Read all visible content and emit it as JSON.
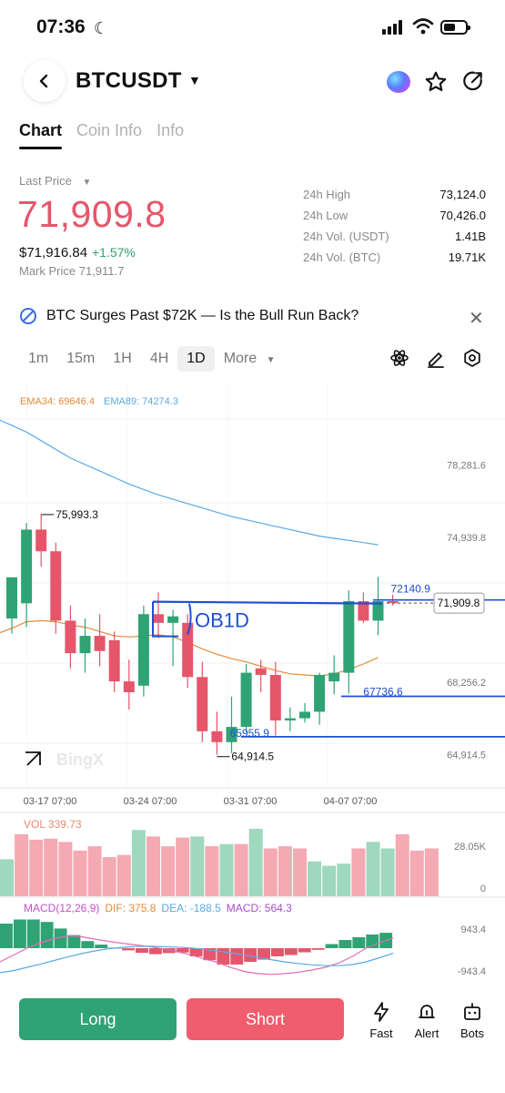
{
  "status_bar": {
    "time": "07:36"
  },
  "header": {
    "symbol": "BTCUSDT"
  },
  "tabs": [
    {
      "label": "Chart",
      "active": true
    },
    {
      "label": "Coin Info",
      "active": false
    },
    {
      "label": "Info",
      "active": false
    }
  ],
  "price": {
    "last_price_label": "Last Price",
    "last_price": "71,909.8",
    "usd_price": "$71,916.84",
    "change": "+1.57%",
    "mark_price": "Mark Price 71,911.7"
  },
  "stats": [
    {
      "label": "24h High",
      "value": "73,124.0"
    },
    {
      "label": "24h Low",
      "value": "70,426.0"
    },
    {
      "label": "24h Vol. (USDT)",
      "value": "1.41B"
    },
    {
      "label": "24h Vol. (BTC)",
      "value": "19.71K"
    }
  ],
  "news": {
    "headline": "BTC Surges Past $72K — Is the Bull Run Back?"
  },
  "timeframes": [
    {
      "label": "1m",
      "active": false
    },
    {
      "label": "15m",
      "active": false
    },
    {
      "label": "1H",
      "active": false
    },
    {
      "label": "4H",
      "active": false
    },
    {
      "label": "1D",
      "active": true
    },
    {
      "label": "More",
      "active": false
    }
  ],
  "indicators": {
    "ema34": "EMA34: 69646.4",
    "ema89": "EMA89: 74274.3",
    "vol": "VOL 339.73",
    "macd_params": "MACD(12,26,9)",
    "dif": "DIF: 375.8",
    "dea": "DEA: -188.5",
    "macd": "MACD: 564.3"
  },
  "chart_data": {
    "type": "candlestick",
    "x_ticks": [
      "03-17 07:00",
      "03-24 07:00",
      "03-31 07:00",
      "04-07 07:00"
    ],
    "y_ticks": [
      "78,281.6",
      "74,939.8",
      "68,256.2",
      "64,914.5"
    ],
    "y_tick_values": [
      78281.6,
      74939.8,
      68256.2,
      64914.5
    ],
    "ylim": [
      63600,
      80400
    ],
    "price_tag": "71,909.8",
    "marks": [
      {
        "label": "75,993.3",
        "value": 75993.3,
        "index": 2
      },
      {
        "label": "64,914.5",
        "value": 64914.5,
        "index": 14
      },
      {
        "label": "65955.9",
        "value": 65955.9,
        "index": 16
      },
      {
        "label": "67736.6",
        "value": 67736.6,
        "index": 23
      },
      {
        "label": "72140.9",
        "value": 72140.9,
        "index": 25
      }
    ],
    "annotation": "OB1D",
    "watermark": "BingX",
    "candles": [
      {
        "o": 71200,
        "h": 72400,
        "l": 70500,
        "c": 73100
      },
      {
        "o": 71900,
        "h": 75600,
        "l": 70800,
        "c": 75300
      },
      {
        "o": 75300,
        "h": 75993.3,
        "l": 73600,
        "c": 74300
      },
      {
        "o": 74300,
        "h": 74700,
        "l": 70500,
        "c": 71100
      },
      {
        "o": 71100,
        "h": 71800,
        "l": 68900,
        "c": 69600
      },
      {
        "o": 69600,
        "h": 71200,
        "l": 68700,
        "c": 70400
      },
      {
        "o": 70400,
        "h": 71400,
        "l": 69000,
        "c": 69700
      },
      {
        "o": 70200,
        "h": 70600,
        "l": 67800,
        "c": 68300
      },
      {
        "o": 68300,
        "h": 69300,
        "l": 67000,
        "c": 67800
      },
      {
        "o": 68100,
        "h": 71800,
        "l": 67600,
        "c": 71400
      },
      {
        "o": 71400,
        "h": 72400,
        "l": 70300,
        "c": 71000
      },
      {
        "o": 71000,
        "h": 71600,
        "l": 69000,
        "c": 71300
      },
      {
        "o": 71000,
        "h": 71400,
        "l": 68000,
        "c": 68500
      },
      {
        "o": 68500,
        "h": 69200,
        "l": 65500,
        "c": 66000
      },
      {
        "o": 66000,
        "h": 66900,
        "l": 64914.5,
        "c": 65500
      },
      {
        "o": 65500,
        "h": 67600,
        "l": 65000,
        "c": 66200
      },
      {
        "o": 66200,
        "h": 69100,
        "l": 65955.9,
        "c": 68700
      },
      {
        "o": 68900,
        "h": 69300,
        "l": 67800,
        "c": 68600
      },
      {
        "o": 68600,
        "h": 69200,
        "l": 65800,
        "c": 66500
      },
      {
        "o": 66500,
        "h": 67100,
        "l": 66000,
        "c": 66600
      },
      {
        "o": 66600,
        "h": 67300,
        "l": 66400,
        "c": 66900
      },
      {
        "o": 66900,
        "h": 68700,
        "l": 66300,
        "c": 68600
      },
      {
        "o": 68300,
        "h": 69500,
        "l": 67700,
        "c": 68700
      },
      {
        "o": 68700,
        "h": 72500,
        "l": 67736.6,
        "c": 72000
      },
      {
        "o": 72000,
        "h": 72400,
        "l": 71000,
        "c": 71100
      },
      {
        "o": 71100,
        "h": 73124,
        "l": 70426,
        "c": 72000
      },
      {
        "o": 72000,
        "h": 72300,
        "l": 71800,
        "c": 71909.8
      }
    ],
    "ema89": [
      80400,
      80100,
      79800,
      79400,
      79000,
      78600,
      78300,
      78000,
      77700,
      77400,
      77150,
      76900,
      76700,
      76500,
      76300,
      76100,
      75900,
      75750,
      75600,
      75450,
      75300,
      75150,
      75000,
      74900,
      74800,
      74700,
      74600
    ],
    "ema34": [
      70500,
      70750,
      71050,
      71100,
      71050,
      70900,
      70800,
      70600,
      70400,
      70350,
      70400,
      70450,
      70350,
      70100,
      69800,
      69550,
      69350,
      69200,
      69000,
      68800,
      68650,
      68600,
      68550,
      68650,
      68850,
      69100,
      69400
    ],
    "volume": {
      "ticks": [
        "28.05K",
        "0"
      ],
      "max": 31000,
      "values": [
        17000,
        28500,
        26000,
        26500,
        25000,
        21000,
        23000,
        18000,
        19000,
        30500,
        27500,
        23000,
        27000,
        27500,
        23000,
        24000,
        24000,
        31000,
        22000,
        23000,
        22000,
        16000,
        14000,
        15000,
        22000,
        25000,
        22000,
        28500,
        21000,
        22000
      ]
    },
    "macd": {
      "ticks": [
        "943.4",
        "-943.4"
      ],
      "range": [
        -1300,
        1300
      ],
      "hist": [
        900,
        1050,
        1050,
        960,
        720,
        480,
        260,
        130,
        20,
        -80,
        -170,
        -220,
        -180,
        -160,
        -300,
        -440,
        -600,
        -600,
        -500,
        -420,
        -300,
        -250,
        -150,
        -60,
        150,
        300,
        400,
        500,
        564
      ],
      "dif": [
        -500,
        -250,
        0,
        200,
        350,
        450,
        420,
        330,
        250,
        180,
        120,
        60,
        -20,
        -120,
        -240,
        -380,
        -520,
        -700,
        -850,
        -930,
        -960,
        -930,
        -880,
        -800,
        -700,
        -540,
        -300,
        0,
        200,
        376
      ],
      "dea": [
        -900,
        -820,
        -700,
        -580,
        -450,
        -320,
        -200,
        -100,
        -20,
        30,
        60,
        70,
        60,
        40,
        10,
        -40,
        -100,
        -170,
        -250,
        -330,
        -420,
        -500,
        -560,
        -610,
        -640,
        -640,
        -600,
        -500,
        -350,
        -188
      ]
    }
  },
  "actions": {
    "long": "Long",
    "short": "Short",
    "fast": "Fast",
    "alert": "Alert",
    "bots": "Bots"
  },
  "colors": {
    "up": "#2fa374",
    "down": "#e5566a",
    "ema34": "#e58a3a",
    "ema89": "#5aa9e6",
    "drawing": "#1f4fd1"
  }
}
